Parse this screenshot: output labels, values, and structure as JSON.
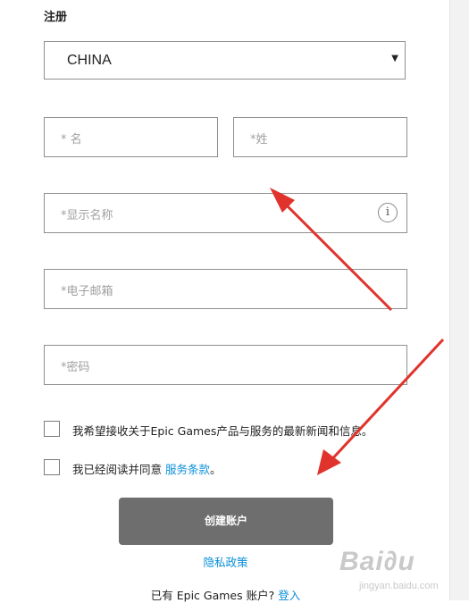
{
  "form": {
    "title": "注册",
    "country_select": {
      "value": "CHINA"
    },
    "first_name": {
      "placeholder": "* 名"
    },
    "last_name": {
      "placeholder": "*姓"
    },
    "display_name": {
      "placeholder": "*显示名称"
    },
    "email": {
      "placeholder": "*电子邮箱"
    },
    "password": {
      "placeholder": "*密码"
    },
    "newsletter_label": "我希望接收关于Epic Games产品与服务的最新新闻和信息。",
    "terms_label_prefix": "我已经阅读并同意",
    "terms_link": "服务条款",
    "terms_label_suffix": "。",
    "create_button": "创建账户",
    "privacy_link": "隐私政策",
    "signin_prefix": "已有 Epic Games 账户?",
    "signin_link": "登入"
  },
  "watermark": {
    "main": "Bai∂u",
    "sub": "jingyan.baidu.com"
  },
  "colors": {
    "link": "#0a8fd8",
    "button_bg": "#6e6e6e",
    "annotation_arrow": "#e0332c"
  }
}
